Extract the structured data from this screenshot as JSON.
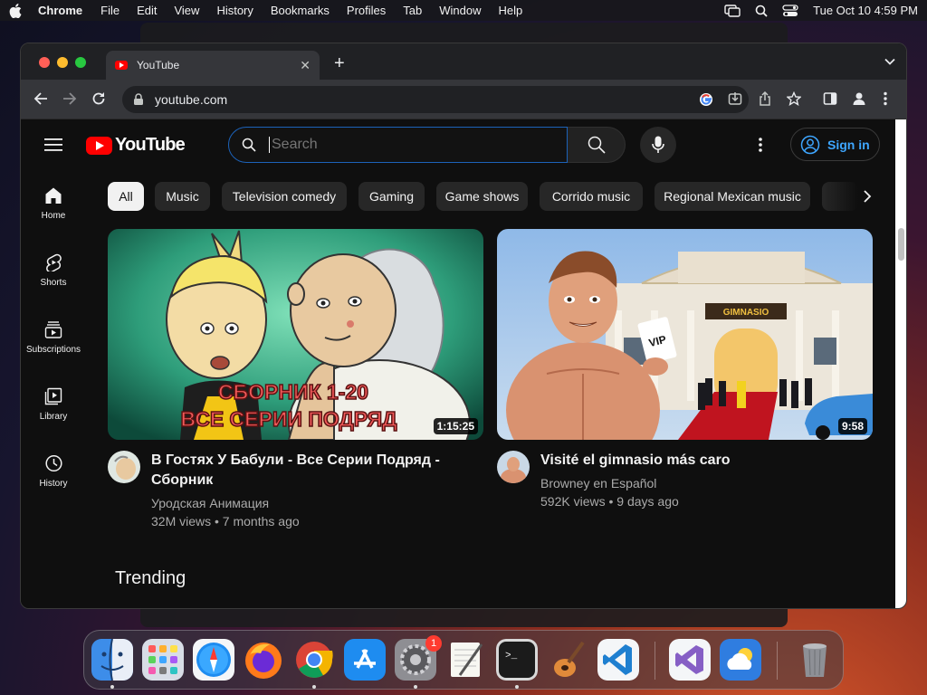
{
  "menubar": {
    "app": "Chrome",
    "items": [
      "File",
      "Edit",
      "View",
      "History",
      "Bookmarks",
      "Profiles",
      "Tab",
      "Window",
      "Help"
    ],
    "clock": "Tue Oct 10  4:59 PM"
  },
  "browser": {
    "tab_title": "YouTube",
    "url": "youtube.com"
  },
  "youtube": {
    "logo_text": "YouTube",
    "search_placeholder": "Search",
    "sign_in": "Sign in",
    "guide": [
      {
        "label": "Home",
        "icon": "home-icon"
      },
      {
        "label": "Shorts",
        "icon": "shorts-icon"
      },
      {
        "label": "Subscriptions",
        "icon": "subscriptions-icon"
      },
      {
        "label": "Library",
        "icon": "library-icon"
      },
      {
        "label": "History",
        "icon": "history-icon"
      }
    ],
    "chips": [
      "All",
      "Music",
      "Television comedy",
      "Gaming",
      "Game shows",
      "Corrido music",
      "Regional Mexican music"
    ],
    "videos": [
      {
        "title": "В Гостях У Бабули - Все Серии Подряд - Сборник",
        "channel": "Уродская Анимация",
        "stats": "32M views • 7 months ago",
        "duration": "1:15:25",
        "thumb_text_1": "СБОРНИК 1-20",
        "thumb_text_2": "ВСЕ СЕРИИ ПОДРЯД"
      },
      {
        "title": "Visité el gimnasio más caro",
        "channel": "Browney en Español",
        "stats": "592K views • 9 days ago",
        "duration": "9:58",
        "thumb_sign": "GIMNASIO",
        "thumb_card": "VIP"
      }
    ],
    "section_title": "Trending"
  },
  "dock": {
    "settings_badge": "1",
    "apps": [
      "finder-icon",
      "launchpad-icon",
      "safari-icon",
      "firefox-icon",
      "chrome-icon",
      "app-store-icon",
      "system-settings-icon",
      "textedit-icon",
      "terminal-icon",
      "garageband-icon",
      "vscode-icon",
      "visual-studio-icon",
      "weather-icon",
      "trash-icon"
    ]
  },
  "colors": {
    "yt_red": "#ff0000",
    "link_blue": "#3ea6ff",
    "search_focus": "#1c62b9",
    "page_bg": "#0f0f0f"
  }
}
